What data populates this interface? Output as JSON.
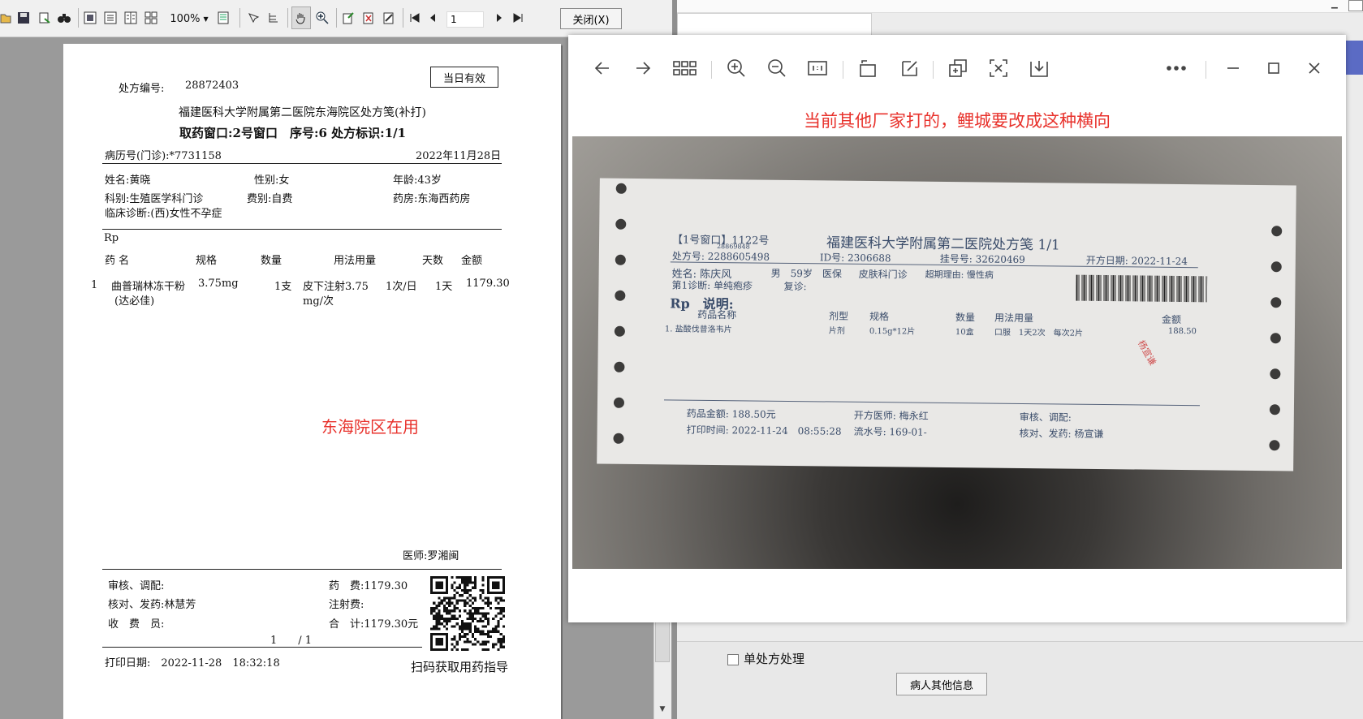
{
  "viewer": {
    "zoom": "100%",
    "page": "1",
    "close_label": "关闭(X)"
  },
  "prescription": {
    "number_label": "处方编号:",
    "number": "28872403",
    "valid_badge": "当日有效",
    "title": "福建医科大学附属第二医院东海院区处方笺(补打)",
    "window_line": "取药窗口:2号窗口　序号:6 处方标识:1/1",
    "record_no": "病历号(门诊):*7731158",
    "date": "2022年11月28日",
    "name": "姓名:黄晓",
    "gender": "性别:女",
    "age": "年龄:43岁",
    "dept": "科别:生殖医学科门诊",
    "fee_type": "费别:自费",
    "pharmacy": "药房:东海西药房",
    "diagnosis": "临床诊断:(西)女性不孕症",
    "rp": "Rp",
    "headers": [
      "药 名",
      "规格",
      "数量",
      "用法用量",
      "天数",
      "金额"
    ],
    "item": {
      "index": "1",
      "name": "曲普瑞林冻干粉",
      "name2": "(达必佳)",
      "spec": "3.75mg",
      "qty": "1支",
      "usage": "皮下注射3.75",
      "usage2": "mg/次",
      "freq": "1次/日",
      "days": "1天",
      "amount": "1179.30"
    },
    "doctor": "医师:罗湘闽",
    "review": "审核、调配:",
    "check": "核对、发药:林慧芳",
    "cashier": "收　费　员:",
    "drug_fee": "药　费:1179.30",
    "inject_fee": "注射费:",
    "total": "合　计:1179.30元",
    "page_count": "1　　/ 1",
    "print_date": "打印日期:　2022-11-28　18:32:18",
    "qr_caption": "扫码获取用药指导",
    "annotation": "东海院区在用"
  },
  "photo_viewer": {
    "annotation": "当前其他厂家打的，鲤城要改成这种横向"
  },
  "photo_slip": {
    "window": "【1号窗口】1122号",
    "small_no": "28869848",
    "title": "福建医科大学附属第二医院处方笺 1/1",
    "rx_no": "处方号: 2288605498",
    "id_no": "ID号: 2306688",
    "reg_no": "挂号号: 32620469",
    "rx_date": "开方日期: 2022-11-24",
    "name": "姓名: 陈庆风",
    "sex_age": "男　59岁　医保",
    "dept": "皮肤科门诊",
    "overdue": "超期理由: 慢性病",
    "diag": "第1诊断: 单纯疱疹",
    "revisit": "复诊:",
    "rp": "Rp　说明:",
    "h_name": "药品名称",
    "h_form": "剂型",
    "h_spec": "规格",
    "h_qty": "数量",
    "h_usage": "用法用量",
    "h_amount": "金额",
    "r_name": "1. 盐酸伐昔洛韦片",
    "r_form": "片剂",
    "r_spec": "0.15g*12片",
    "r_qty": "10盒",
    "r_usage": "口服　1天2次　每次2片",
    "r_amount": "188.50",
    "stamp": "杨宣谦",
    "drug_total": "药品金额: 188.50元",
    "doctor": "开方医师: 梅永红",
    "review": "审核、调配:",
    "print_time": "打印时间: 2022-11-24　08:55:28",
    "serial": "流水号: 169-01-",
    "dispense": "核对、发药: 杨宣谦"
  },
  "background_app": {
    "checkbox_label": "单处方处理",
    "patient_button": "病人其他信息"
  }
}
